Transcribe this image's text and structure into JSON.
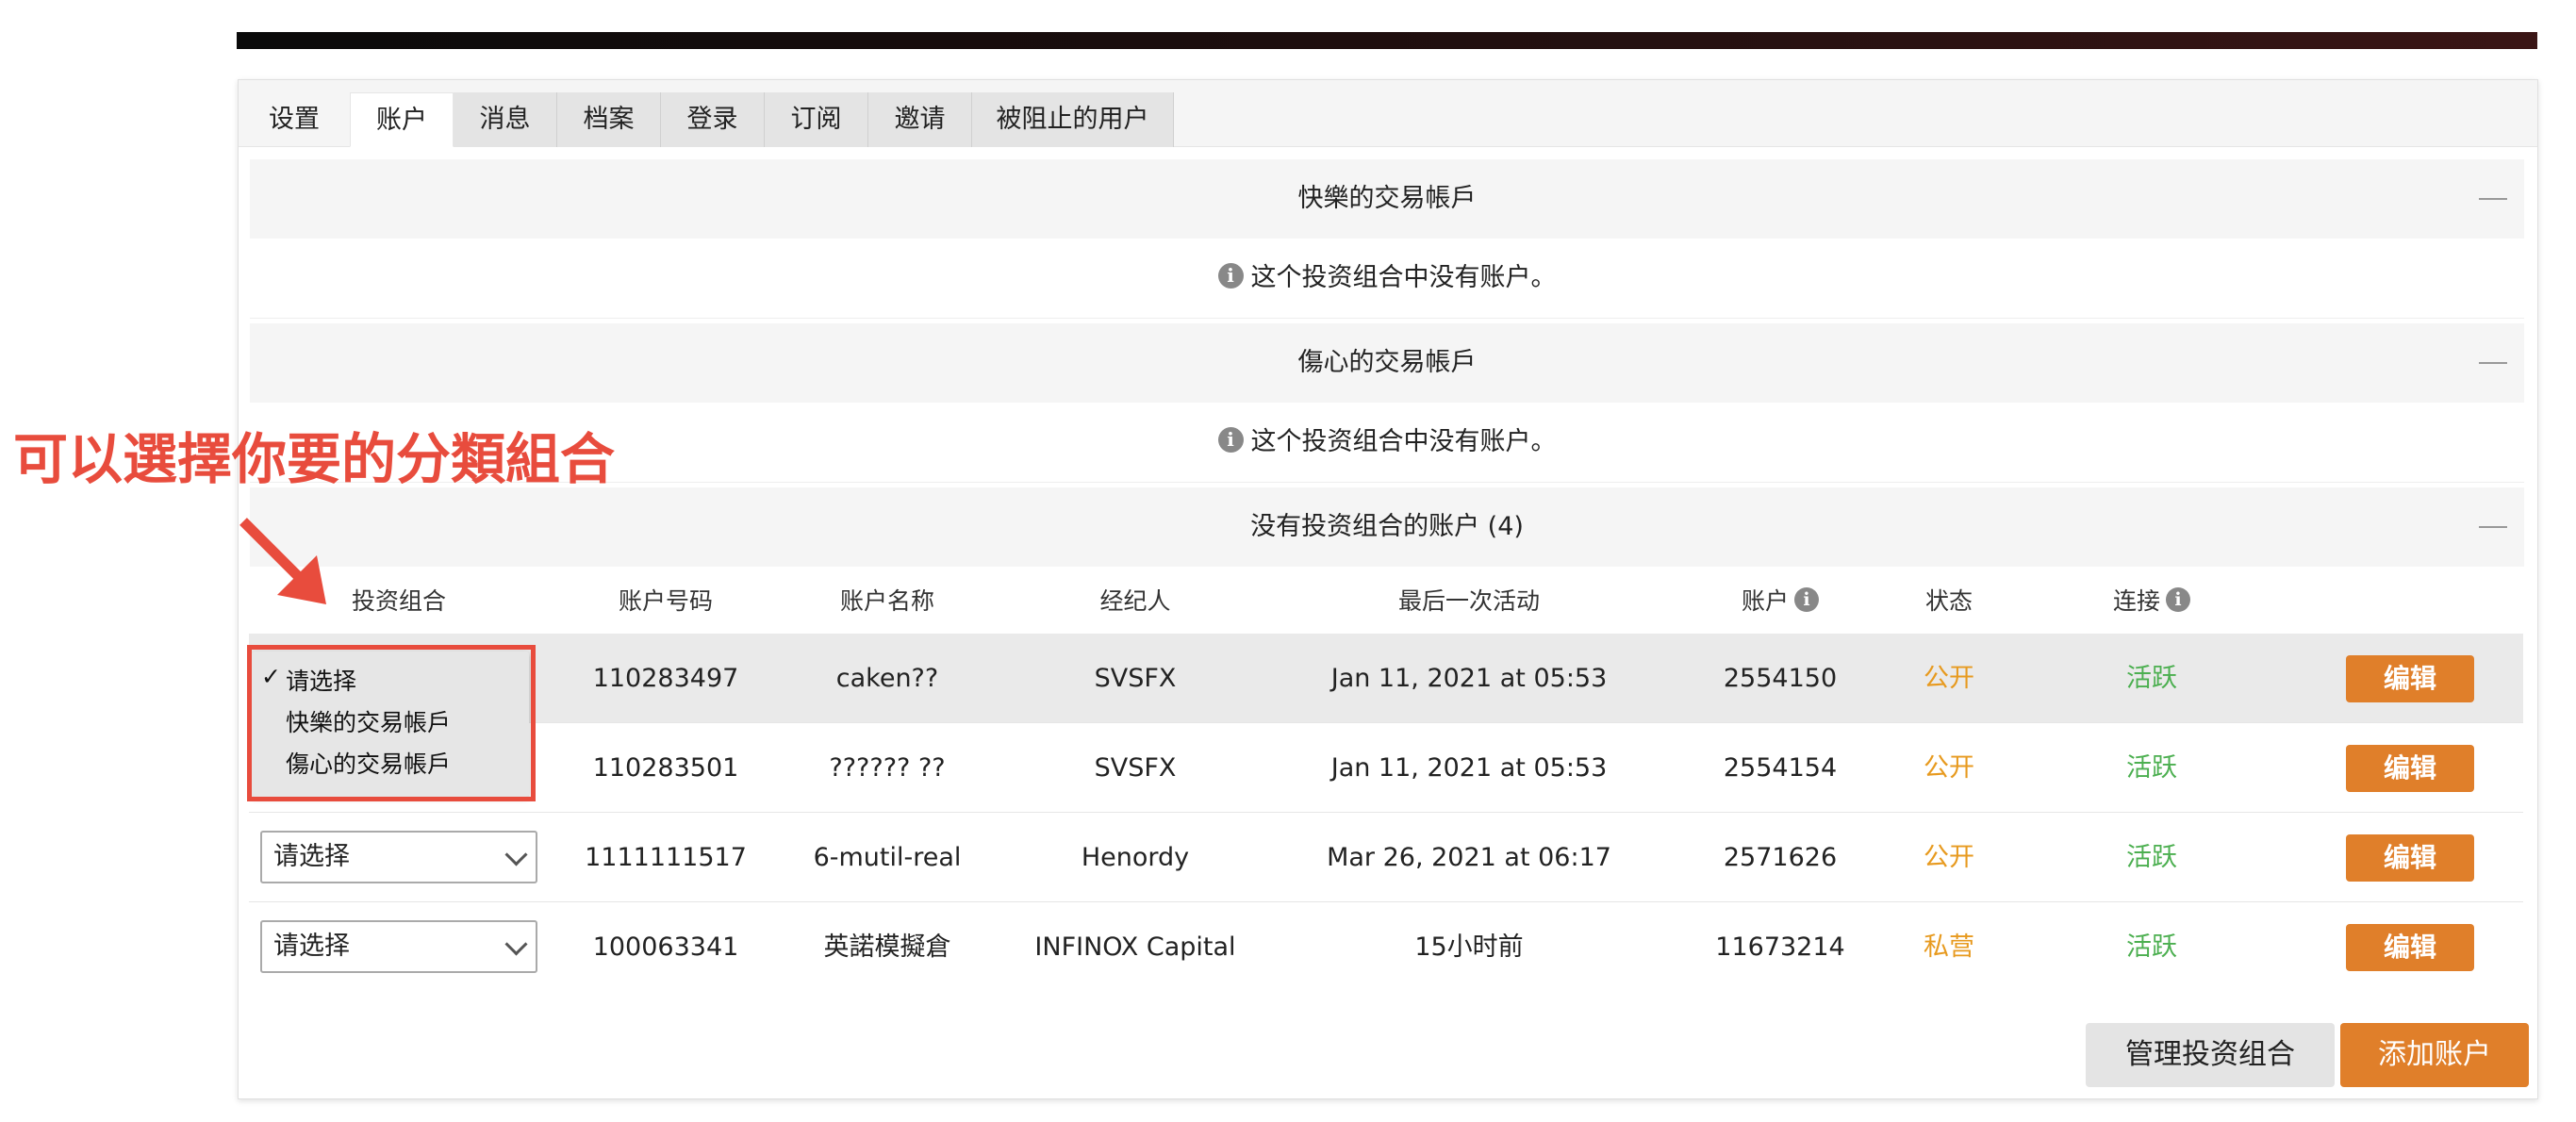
{
  "tabs": [
    {
      "label": "设置"
    },
    {
      "label": "账户"
    },
    {
      "label": "消息"
    },
    {
      "label": "档案"
    },
    {
      "label": "登录"
    },
    {
      "label": "订阅"
    },
    {
      "label": "邀请"
    },
    {
      "label": "被阻止的用户"
    }
  ],
  "portfolios": [
    {
      "title": "快樂的交易帳戶",
      "empty_message": "这个投资组合中没有账户。"
    },
    {
      "title": "傷心的交易帳戶",
      "empty_message": "这个投资组合中没有账户。"
    }
  ],
  "unassigned": {
    "title": "没有投资组合的账户 (4)",
    "columns": [
      "投资组合",
      "账户号码",
      "账户名称",
      "经纪人",
      "最后一次活动",
      "账户",
      "状态",
      "连接"
    ],
    "select_placeholder": "请选择",
    "edit_label": "编辑",
    "rows": [
      {
        "number": "110283497",
        "name": "caken??",
        "broker": "SVSFX",
        "last_activity": "Jan 11, 2021 at 05:53",
        "account": "2554150",
        "status": "公开",
        "connection": "活跃"
      },
      {
        "number": "110283501",
        "name": "?????? ??",
        "broker": "SVSFX",
        "last_activity": "Jan 11, 2021 at 05:53",
        "account": "2554154",
        "status": "公开",
        "connection": "活跃"
      },
      {
        "number": "1111111517",
        "name": "6-mutil-real",
        "broker": "Henordy",
        "last_activity": "Mar 26, 2021 at 06:17",
        "account": "2571626",
        "status": "公开",
        "connection": "活跃"
      },
      {
        "number": "100063341",
        "name": "英諾模擬倉",
        "broker": "INFINOX Capital",
        "last_activity": "15小时前",
        "account": "11673214",
        "status": "私营",
        "connection": "活跃"
      }
    ]
  },
  "dropdown": {
    "options": [
      "请选择",
      "快樂的交易帳戶",
      "傷心的交易帳戶"
    ],
    "selected": "请选择",
    "check": "✓"
  },
  "annotation": "可以選擇你要的分類組合",
  "footer": {
    "manage_label": "管理投资组合",
    "add_label": "添加账户"
  },
  "colors": {
    "accent": "#e07f2a",
    "annotation": "#e84c3d",
    "active": "#4caf50",
    "status": "#e79a1f"
  }
}
